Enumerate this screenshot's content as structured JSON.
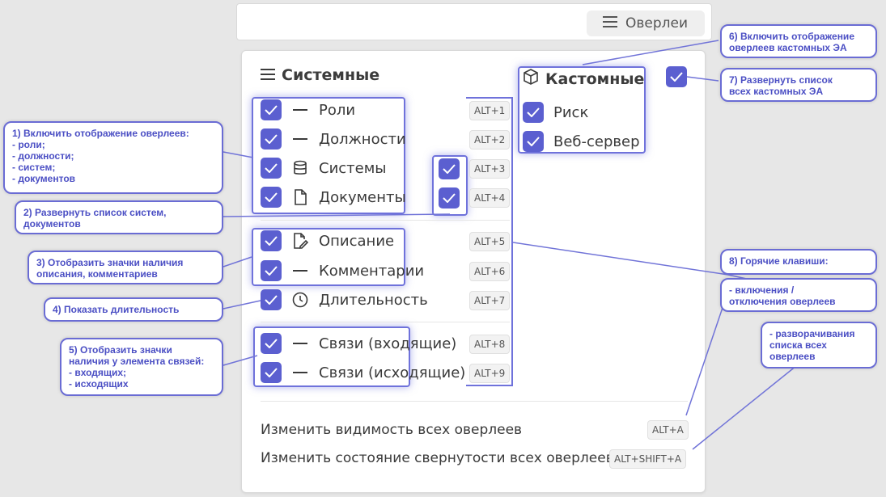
{
  "header": {
    "overlays_button": "Оверлеи"
  },
  "system": {
    "title": "Системные",
    "items": [
      {
        "label": "Роли",
        "shortcut": "ALT+1",
        "icon": "dash-icon",
        "checked": true
      },
      {
        "label": "Должности",
        "shortcut": "ALT+2",
        "icon": "dash-icon",
        "checked": true
      },
      {
        "label": "Системы",
        "shortcut": "ALT+3",
        "icon": "database-icon",
        "checked": true
      },
      {
        "label": "Документы",
        "shortcut": "ALT+4",
        "icon": "file-icon",
        "checked": true
      },
      {
        "label": "Описание",
        "shortcut": "ALT+5",
        "icon": "file-edit-icon",
        "checked": true
      },
      {
        "label": "Комментарии",
        "shortcut": "ALT+6",
        "icon": "dash-icon",
        "checked": true
      },
      {
        "label": "Длительность",
        "shortcut": "ALT+7",
        "icon": "clock-icon",
        "checked": true
      },
      {
        "label": "Связи (входящие)",
        "shortcut": "ALT+8",
        "icon": "dash-icon",
        "checked": true
      },
      {
        "label": "Связи (исходящие)",
        "shortcut": "ALT+9",
        "icon": "dash-icon",
        "checked": true
      }
    ]
  },
  "custom": {
    "title": "Кастомные",
    "items": [
      {
        "label": "Риск",
        "checked": true
      },
      {
        "label": "Веб-сервер",
        "checked": true
      }
    ]
  },
  "footer": {
    "visibility_label": "Изменить видимость всех оверлеев",
    "visibility_shortcut": "ALT+A",
    "collapse_label": "Изменить состояние свернутости всех оверлеев",
    "collapse_shortcut": "ALT+SHIFT+A"
  },
  "callouts": {
    "c1": [
      "1) Включить отображение оверлеев:",
      "- роли;",
      "- должности;",
      "- систем;",
      "- документов"
    ],
    "c2": [
      "2) Развернуть список систем,",
      "документов"
    ],
    "c3": [
      "3) Отобразить значки наличия",
      "описания, комментариев"
    ],
    "c4": [
      "4) Показать длительность"
    ],
    "c5": [
      "5) Отобразить значки",
      "наличия у элемента связей:",
      "- входящих;",
      "- исходящих"
    ],
    "c6": [
      "6) Включить отображение",
      "оверлеев кастомных ЭА"
    ],
    "c7": [
      "7) Развернуть список",
      "всех кастомных ЭА"
    ],
    "c8": [
      "8) Горячие клавиши:"
    ],
    "c8a": [
      "- включения /",
      "отключения оверлеев"
    ],
    "c8b": [
      "- разворачивания",
      "списка всех",
      "оверлеев"
    ]
  },
  "colors": {
    "accent": "#5b5fd0",
    "callout_text": "#4b4fc4"
  }
}
